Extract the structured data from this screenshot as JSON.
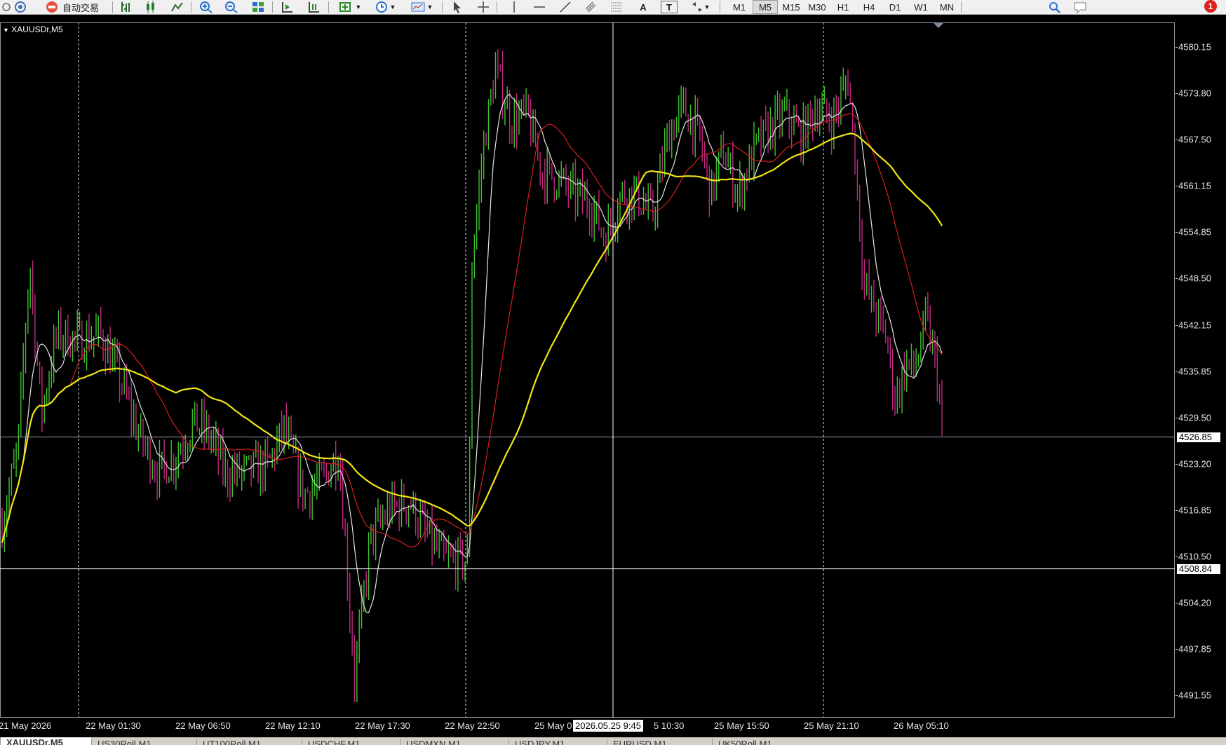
{
  "toolbar": {
    "autotrade_label": "自动交易",
    "draw_tools": [
      "cursor-icon",
      "crosshair-icon",
      "vertical-line-icon",
      "horizontal-line-icon",
      "trendline-icon",
      "equidistant-channel-icon",
      "fibonacci-icon",
      "text-icon",
      "text-label-icon",
      "arrows-icon"
    ],
    "text_tool_label": "A",
    "label_tool_label": "T",
    "timeframes": [
      "M1",
      "M5",
      "M15",
      "M30",
      "H1",
      "H4",
      "D1",
      "W1",
      "MN"
    ],
    "active_timeframe": "M5",
    "notifications_count": "1"
  },
  "chart": {
    "symbol_label": "XAUUSDr,M5",
    "background": "#000000",
    "bull_color": "#3cc12b",
    "bear_color": "#c02882",
    "ma_fast_color": "#e6e6e6",
    "ma_mid_color": "#d81e1e",
    "ma_slow_color": "#f0e614",
    "price_scale": [
      "4580.15",
      "4573.80",
      "4567.50",
      "4561.15",
      "4554.85",
      "4548.50",
      "4542.15",
      "4535.85",
      "4529.50",
      "4523.20",
      "4516.85",
      "4510.50",
      "4504.20",
      "4497.85",
      "4491.55"
    ],
    "current_price": "4526.85",
    "crosshair_price": "4508.84",
    "crosshair_time": "2026.05.25 9:45",
    "time_labels": [
      "21 May 2026",
      "22 May 01:30",
      "22 May 06:50",
      "22 May 12:10",
      "22 May 17:30",
      "22 May 22:50",
      "25 May 0",
      "5 10:30",
      "25 May 15:50",
      "25 May 21:10",
      "26 May 05:10"
    ]
  },
  "tabs": [
    "XAUUSDr,M5",
    "US30Roll,M1",
    "UT100Roll,M1",
    "USDCHF,M1",
    "USDMXN,M1",
    "USDJPY,M1",
    "EURUSD,M1",
    "UK50Roll,M1"
  ],
  "chart_data": {
    "type": "candlestick",
    "symbol": "XAUUSDr",
    "timeframe": "M5",
    "x": [
      "21 May 2026",
      "22 May 01:30",
      "22 May 06:50",
      "22 May 12:10",
      "22 May 17:30",
      "22 May 22:50",
      "25 May 05:10",
      "25 May 10:30",
      "25 May 15:50",
      "25 May 21:10",
      "26 May 05:10"
    ],
    "ylim": [
      4488.5,
      4583.5
    ],
    "yticks": [
      4580.15,
      4573.8,
      4567.5,
      4561.15,
      4554.85,
      4548.5,
      4542.15,
      4535.85,
      4529.5,
      4523.2,
      4516.85,
      4510.5,
      4504.2,
      4497.85,
      4491.55
    ],
    "current_price": 4526.85,
    "close_path": [
      {
        "x": 0,
        "c": 4515
      },
      {
        "x": 20,
        "c": 4525
      },
      {
        "x": 35,
        "c": 4551
      },
      {
        "x": 50,
        "c": 4530
      },
      {
        "x": 70,
        "c": 4541
      },
      {
        "x": 100,
        "c": 4540
      },
      {
        "x": 125,
        "c": 4541
      },
      {
        "x": 150,
        "c": 4535
      },
      {
        "x": 175,
        "c": 4527
      },
      {
        "x": 200,
        "c": 4522
      },
      {
        "x": 220,
        "c": 4524
      },
      {
        "x": 245,
        "c": 4529
      },
      {
        "x": 265,
        "c": 4527
      },
      {
        "x": 285,
        "c": 4522
      },
      {
        "x": 310,
        "c": 4522
      },
      {
        "x": 340,
        "c": 4523
      },
      {
        "x": 360,
        "c": 4528
      },
      {
        "x": 385,
        "c": 4519
      },
      {
        "x": 410,
        "c": 4521
      },
      {
        "x": 430,
        "c": 4525
      },
      {
        "x": 450,
        "c": 4494
      },
      {
        "x": 470,
        "c": 4513
      },
      {
        "x": 495,
        "c": 4517
      },
      {
        "x": 520,
        "c": 4518
      },
      {
        "x": 545,
        "c": 4513
      },
      {
        "x": 565,
        "c": 4510
      },
      {
        "x": 595,
        "c": 4510
      },
      {
        "x": 600,
        "c": 4551
      },
      {
        "x": 615,
        "c": 4567
      },
      {
        "x": 630,
        "c": 4577
      },
      {
        "x": 650,
        "c": 4570
      },
      {
        "x": 670,
        "c": 4571
      },
      {
        "x": 690,
        "c": 4563
      },
      {
        "x": 710,
        "c": 4562
      },
      {
        "x": 730,
        "c": 4560
      },
      {
        "x": 750,
        "c": 4559
      },
      {
        "x": 770,
        "c": 4554
      },
      {
        "x": 790,
        "c": 4560
      },
      {
        "x": 810,
        "c": 4560
      },
      {
        "x": 830,
        "c": 4557
      },
      {
        "x": 850,
        "c": 4568
      },
      {
        "x": 870,
        "c": 4572
      },
      {
        "x": 890,
        "c": 4568
      },
      {
        "x": 905,
        "c": 4560
      },
      {
        "x": 920,
        "c": 4566
      },
      {
        "x": 940,
        "c": 4560
      },
      {
        "x": 960,
        "c": 4566
      },
      {
        "x": 980,
        "c": 4569
      },
      {
        "x": 1000,
        "c": 4571
      },
      {
        "x": 1020,
        "c": 4568
      },
      {
        "x": 1040,
        "c": 4572
      },
      {
        "x": 1060,
        "c": 4570
      },
      {
        "x": 1080,
        "c": 4576
      },
      {
        "x": 1090,
        "c": 4564
      },
      {
        "x": 1100,
        "c": 4548
      },
      {
        "x": 1115,
        "c": 4544
      },
      {
        "x": 1130,
        "c": 4540
      },
      {
        "x": 1140,
        "c": 4532
      },
      {
        "x": 1155,
        "c": 4537
      },
      {
        "x": 1165,
        "c": 4536
      },
      {
        "x": 1180,
        "c": 4543
      },
      {
        "x": 1195,
        "c": 4535
      },
      {
        "x": 1200,
        "c": 4526.85
      }
    ],
    "moving_averages": [
      {
        "name": "fast",
        "color": "#e6e6e6"
      },
      {
        "name": "mid",
        "color": "#d81e1e"
      },
      {
        "name": "slow",
        "color": "#f0e614"
      }
    ]
  }
}
